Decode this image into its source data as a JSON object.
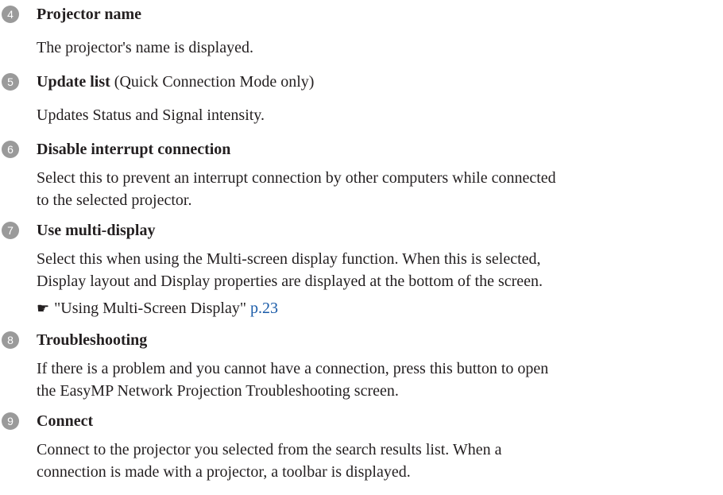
{
  "items": [
    {
      "number": "4",
      "title": "Projector name",
      "description": "The projector's name is displayed."
    },
    {
      "number": "5",
      "title": "Update list",
      "title_note": "(Quick Connection Mode only)",
      "description": "Updates Status and Signal intensity."
    },
    {
      "number": "6",
      "title": "Disable interrupt connection",
      "description_line1": "Select this to prevent an interrupt connection by other computers while connected",
      "description_line2": "to the selected projector."
    },
    {
      "number": "7",
      "title": "Use multi-display",
      "description_line1": "Select this when using the Multi-screen display function. When this is selected,",
      "description_line2": "Display layout and Display properties are displayed at the bottom of the screen.",
      "reference_text": "\"Using Multi-Screen Display\"",
      "reference_link": "p.23",
      "reference_icon": "pointing-hand-icon"
    },
    {
      "number": "8",
      "title": "Troubleshooting",
      "description_line1": "If there is a problem and you cannot have a connection, press this button to open",
      "description_line2": "the EasyMP Network Projection Troubleshooting screen."
    },
    {
      "number": "9",
      "title": "Connect",
      "description_line1": "Connect to the projector you selected from the search results list. When a",
      "description_line2": "connection is made with a projector, a toolbar is displayed."
    }
  ],
  "colors": {
    "text": "#231f20",
    "badge": "#9a9a9a",
    "link": "#1a5ba8"
  }
}
